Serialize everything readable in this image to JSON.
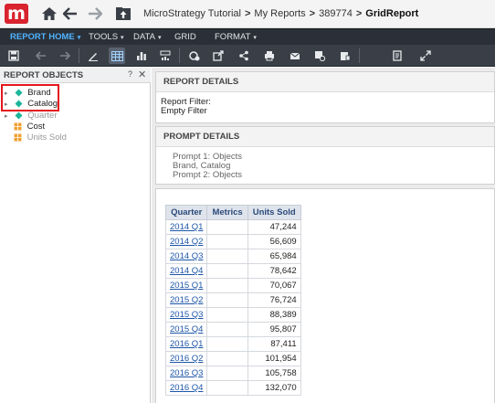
{
  "header": {
    "logo_text": "m",
    "breadcrumbs": [
      "MicroStrategy Tutorial",
      "My Reports",
      "389774"
    ],
    "current": "GridReport",
    "separator": ">"
  },
  "menubar": {
    "items": [
      {
        "label": "REPORT HOME",
        "active": true
      },
      {
        "label": "TOOLS"
      },
      {
        "label": "DATA"
      },
      {
        "label": "GRID"
      },
      {
        "label": "FORMAT"
      }
    ],
    "caret": "▾"
  },
  "left_panel": {
    "title": "REPORT OBJECTS",
    "help": "?",
    "close": "✕",
    "tree": [
      {
        "label": "Brand",
        "type": "attribute",
        "expandable": true
      },
      {
        "label": "Catalog",
        "type": "attribute",
        "expandable": true
      },
      {
        "label": "Quarter",
        "type": "attribute",
        "expandable": true,
        "dim": true
      },
      {
        "label": "Cost",
        "type": "metric"
      },
      {
        "label": "Units Sold",
        "type": "metric",
        "dim": true
      }
    ],
    "expander": "▸"
  },
  "report_details": {
    "title": "REPORT DETAILS",
    "lines": [
      "Report Filter:",
      "Empty Filter"
    ]
  },
  "prompt_details": {
    "title": "PROMPT DETAILS",
    "lines": [
      "Prompt 1: Objects",
      "Brand, Catalog",
      "Prompt 2: Objects"
    ]
  },
  "grid": {
    "columns": [
      "Quarter",
      "Metrics",
      "Units Sold"
    ],
    "rows": [
      {
        "quarter": "2014 Q1",
        "units": "47,244"
      },
      {
        "quarter": "2014 Q2",
        "units": "56,609"
      },
      {
        "quarter": "2014 Q3",
        "units": "65,984"
      },
      {
        "quarter": "2014 Q4",
        "units": "78,642"
      },
      {
        "quarter": "2015 Q1",
        "units": "70,067"
      },
      {
        "quarter": "2015 Q2",
        "units": "76,724"
      },
      {
        "quarter": "2015 Q3",
        "units": "88,389"
      },
      {
        "quarter": "2015 Q4",
        "units": "95,807"
      },
      {
        "quarter": "2016 Q1",
        "units": "87,411"
      },
      {
        "quarter": "2016 Q2",
        "units": "101,954"
      },
      {
        "quarter": "2016 Q3",
        "units": "105,758"
      },
      {
        "quarter": "2016 Q4",
        "units": "132,070"
      }
    ]
  },
  "colors": {
    "brand_red": "#d9232e",
    "menu_bg": "#2b3038",
    "toolbar_bg": "#3a3f47",
    "active_menu": "#4fb3ff",
    "attribute_icon": "#1bb59a",
    "metric_icon": "#f0a030",
    "highlight": "#e4161d"
  },
  "icons": {
    "nav": [
      "home-icon",
      "back-arrow-icon",
      "forward-arrow-icon",
      "up-folder-icon"
    ],
    "toolbar": [
      "save-icon",
      "undo-icon",
      "redo-icon",
      "design-mode-icon",
      "grid-view-icon",
      "graph-view-icon",
      "grid-graph-icon",
      "refresh-icon",
      "export-icon",
      "share-icon",
      "print-icon",
      "email-icon",
      "schedule-icon",
      "subscribe-icon",
      "pdf-icon",
      "fullscreen-icon"
    ]
  }
}
